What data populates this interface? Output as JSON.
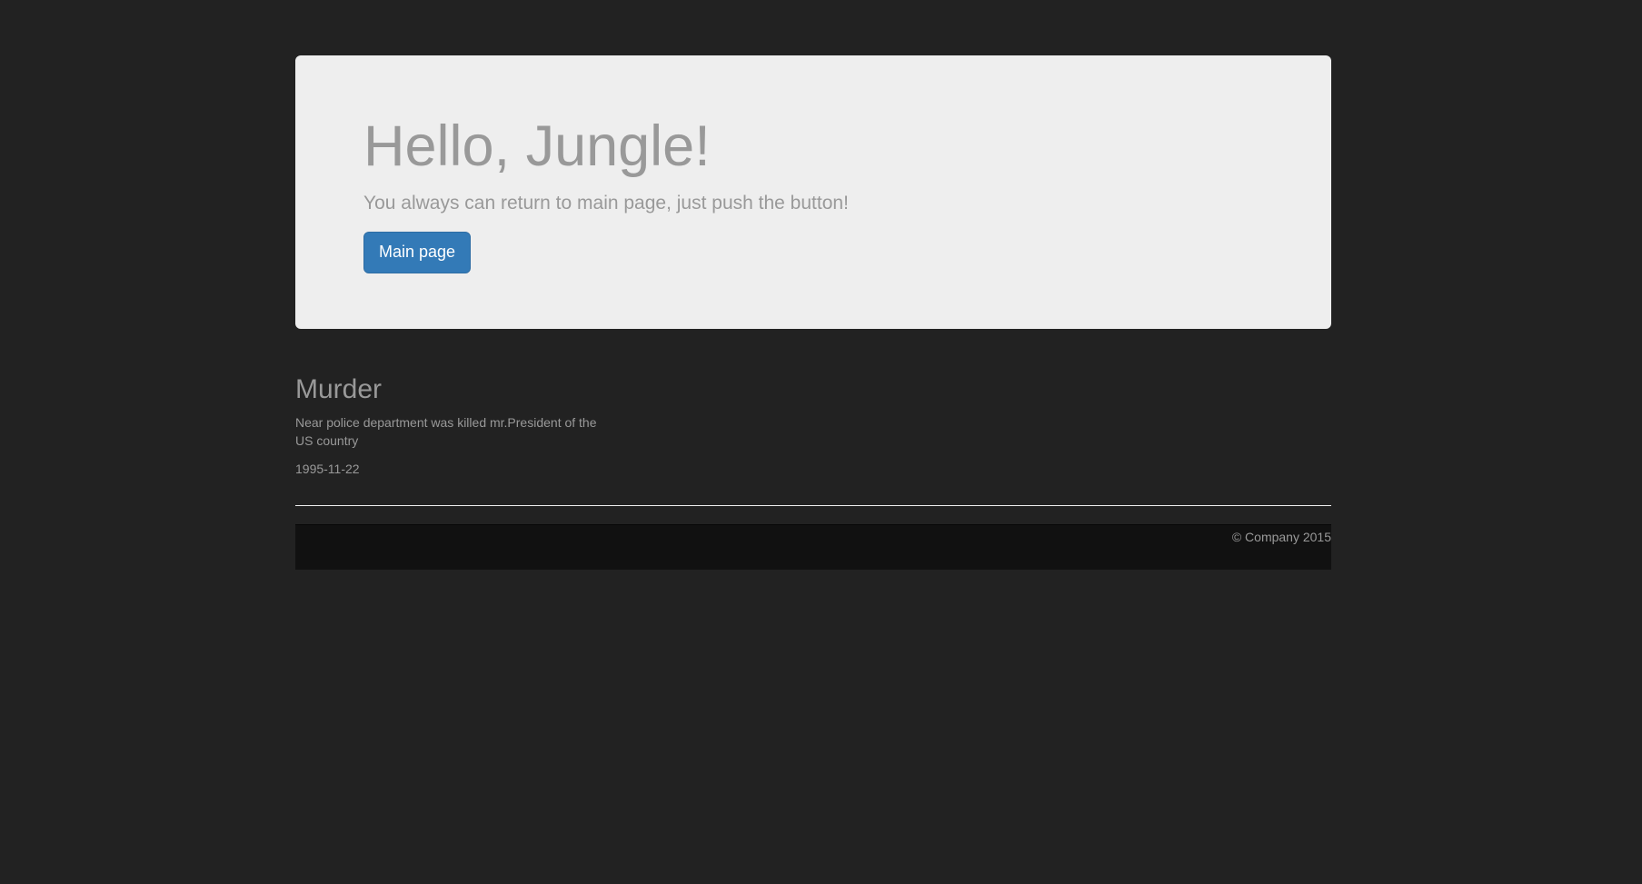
{
  "jumbotron": {
    "title": "Hello, Jungle!",
    "lead": "You always can return to main page, just push the button!",
    "button_label": "Main page"
  },
  "news": {
    "title": "Murder",
    "text": "Near police department was killed mr.President of the US country",
    "date": "1995-11-22"
  },
  "footer": {
    "copyright": "© Company 2015"
  },
  "colors": {
    "background": "#222222",
    "jumbotron_background": "#eeeeee",
    "primary_button": "#337ab7",
    "footer_background": "#111111",
    "text_muted": "#999999"
  }
}
